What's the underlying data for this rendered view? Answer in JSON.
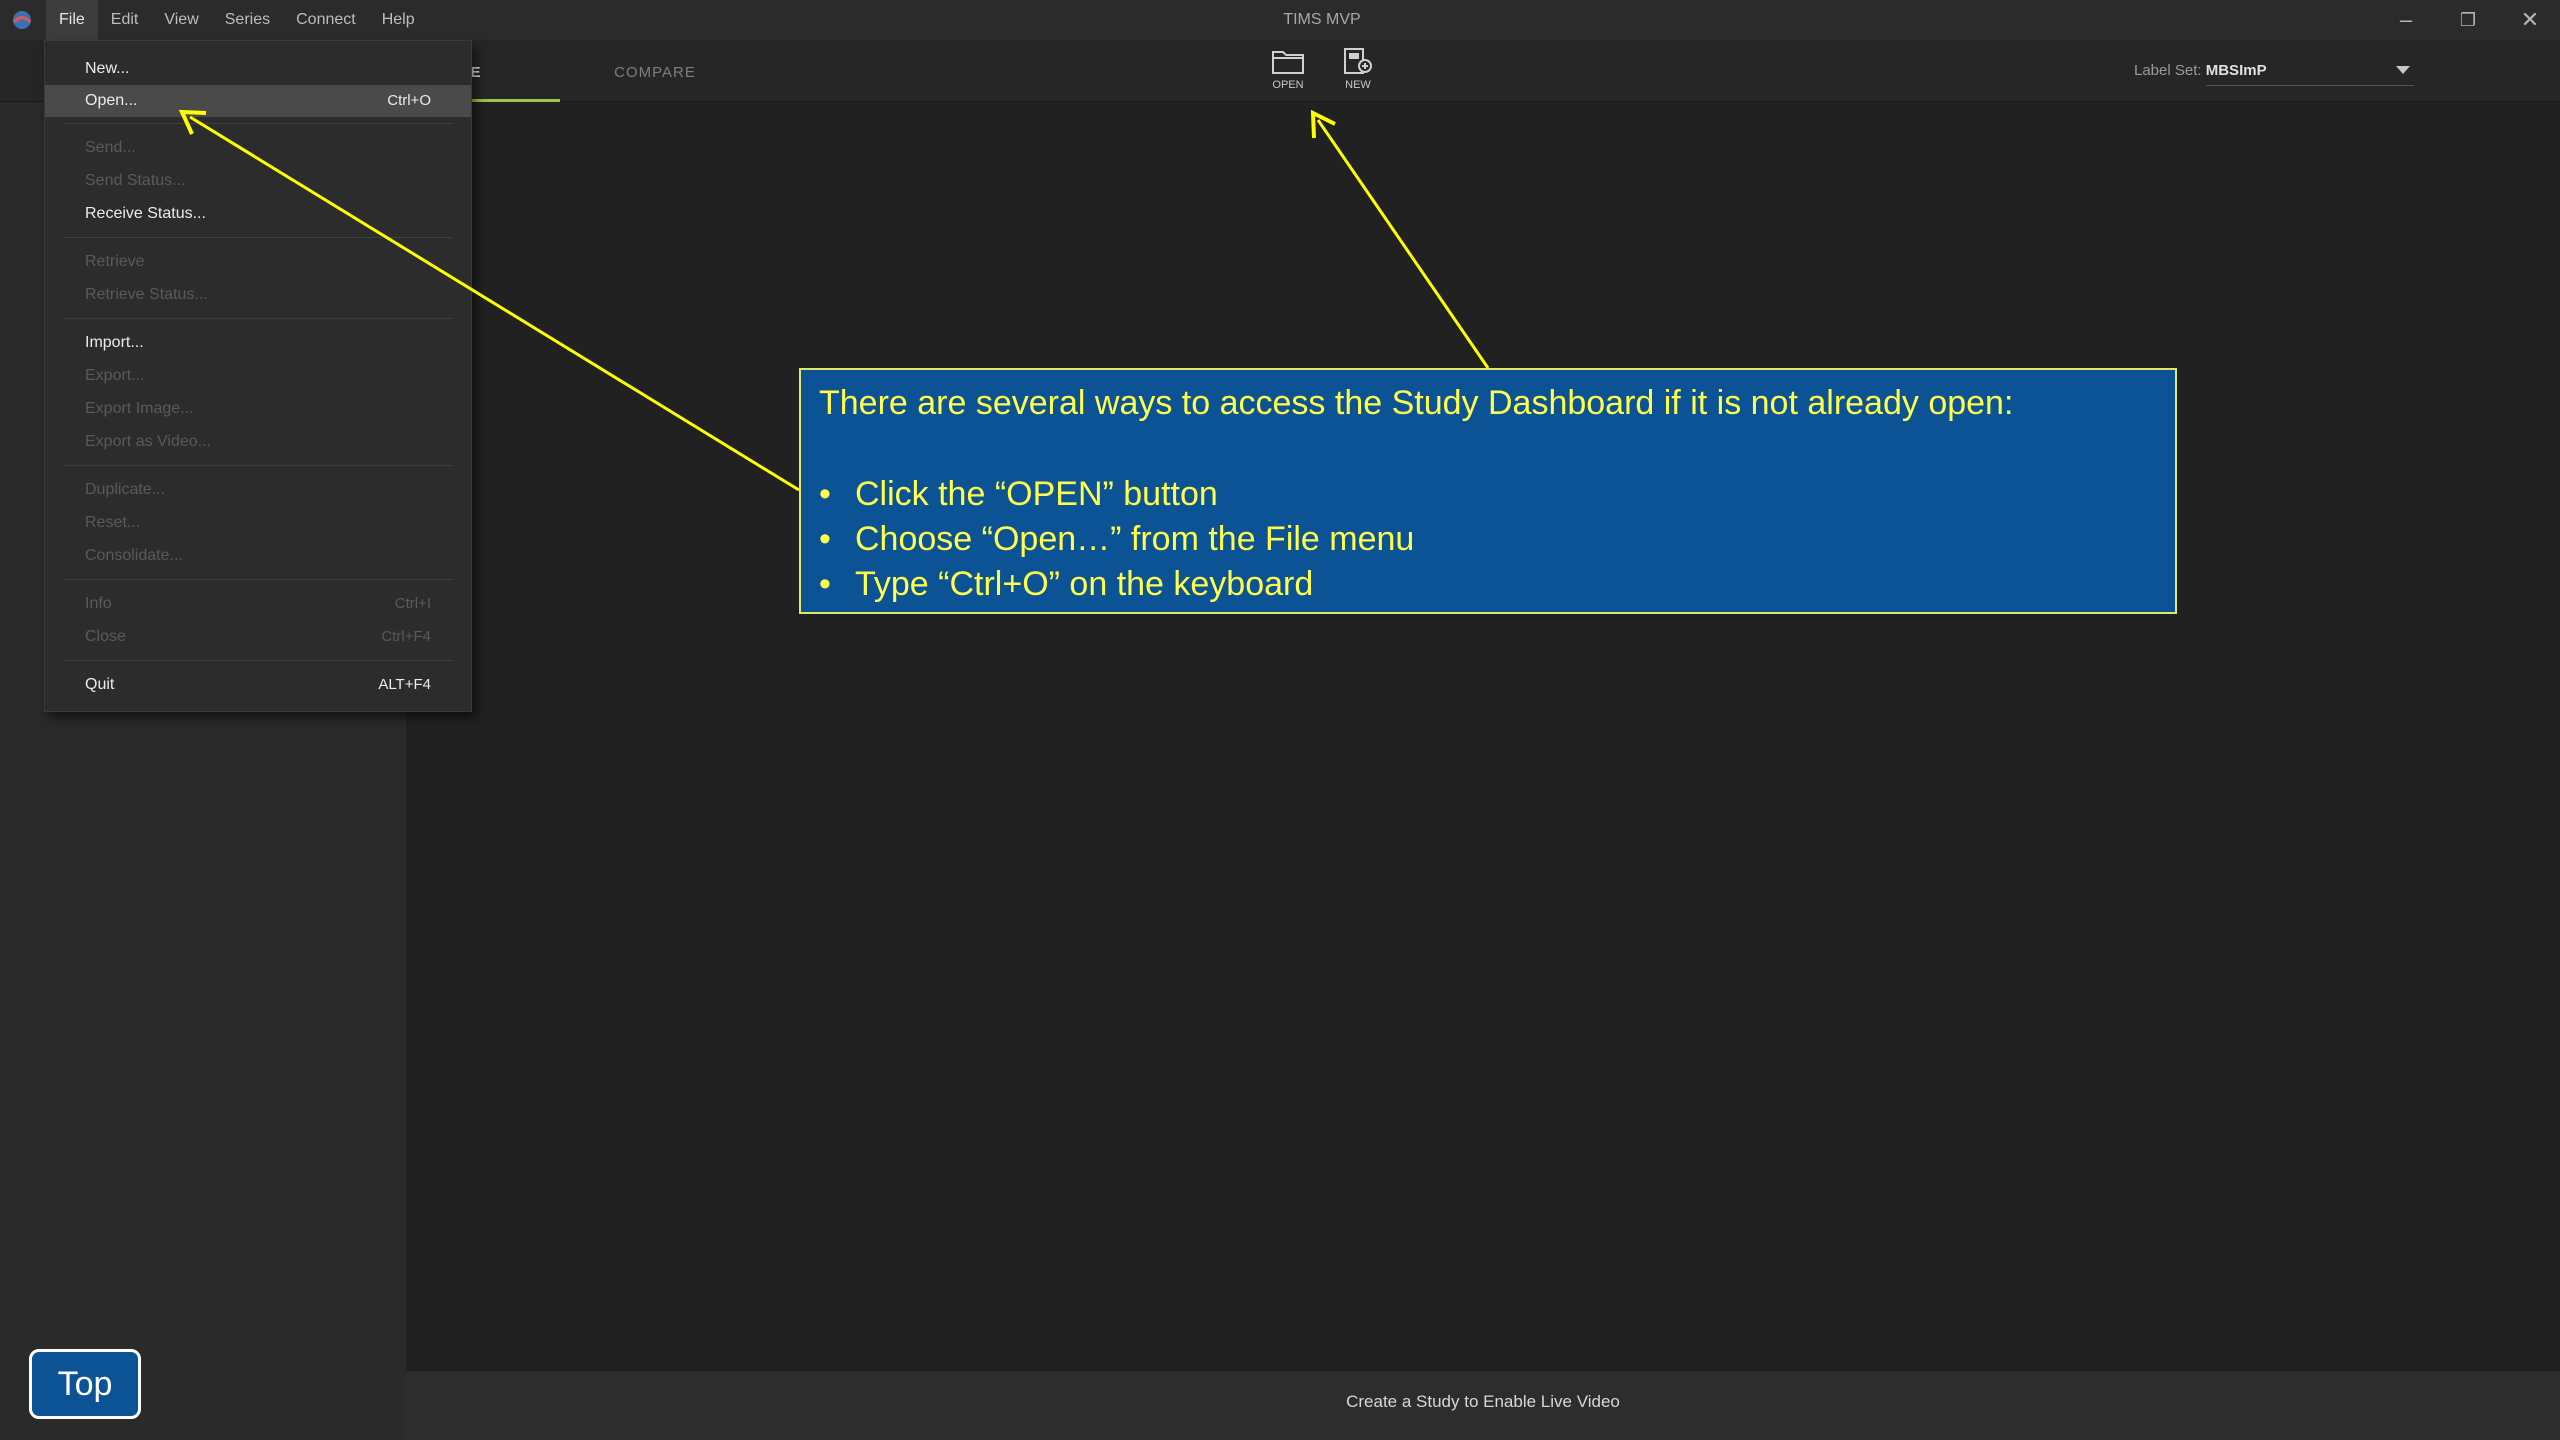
{
  "window": {
    "title": "TIMS MVP",
    "minimize_glyph": "–",
    "maximize_glyph": "❐",
    "close_glyph": "✕"
  },
  "menubar": [
    "File",
    "Edit",
    "View",
    "Series",
    "Connect",
    "Help"
  ],
  "tabs": [
    {
      "label": "E"
    },
    {
      "label": "COMPARE"
    }
  ],
  "toolbar": {
    "open_label": "OPEN",
    "new_label": "NEW",
    "open_icon": "folder-icon",
    "new_icon": "new-study-icon",
    "label_set_prefix": "Label Set:",
    "label_set_value": "MBSImP"
  },
  "file_menu": {
    "items": [
      {
        "label": "New...",
        "shortcut": "",
        "enabled": true
      },
      {
        "label": "Open...",
        "shortcut": "Ctrl+O",
        "enabled": true,
        "highlighted": true
      },
      {
        "label": "Send...",
        "shortcut": "",
        "enabled": false
      },
      {
        "label": "Send Status...",
        "shortcut": "",
        "enabled": false
      },
      {
        "label": "Receive Status...",
        "shortcut": "",
        "enabled": true
      },
      {
        "label": "Retrieve",
        "shortcut": "",
        "enabled": false
      },
      {
        "label": "Retrieve Status...",
        "shortcut": "",
        "enabled": false
      },
      {
        "label": "Import...",
        "shortcut": "",
        "enabled": true
      },
      {
        "label": "Export...",
        "shortcut": "",
        "enabled": false
      },
      {
        "label": "Export Image...",
        "shortcut": "",
        "enabled": false
      },
      {
        "label": "Export as Video...",
        "shortcut": "",
        "enabled": false
      },
      {
        "label": "Duplicate...",
        "shortcut": "",
        "enabled": false
      },
      {
        "label": "Reset...",
        "shortcut": "",
        "enabled": false
      },
      {
        "label": "Consolidate...",
        "shortcut": "",
        "enabled": false
      },
      {
        "label": "Info",
        "shortcut": "Ctrl+I",
        "enabled": false
      },
      {
        "label": "Close",
        "shortcut": "Ctrl+F4",
        "enabled": false
      },
      {
        "label": "Quit",
        "shortcut": "ALT+F4",
        "enabled": true
      }
    ]
  },
  "callout": {
    "intro": "There are several ways to access the Study Dashboard if it is not already open:",
    "bullet": "•",
    "bullets": [
      "Click the “OPEN” button",
      "Choose “Open…” from the File menu",
      "Type “Ctrl+O” on the keyboard"
    ]
  },
  "status_bar": {
    "text": "Create a Study to Enable Live Video"
  },
  "top_button": {
    "label": "Top"
  },
  "colors": {
    "callout_bg": "#0b5394",
    "callout_text": "#ffff4d",
    "arrow": "#ffff00",
    "tab_accent": "#9bc44a"
  }
}
